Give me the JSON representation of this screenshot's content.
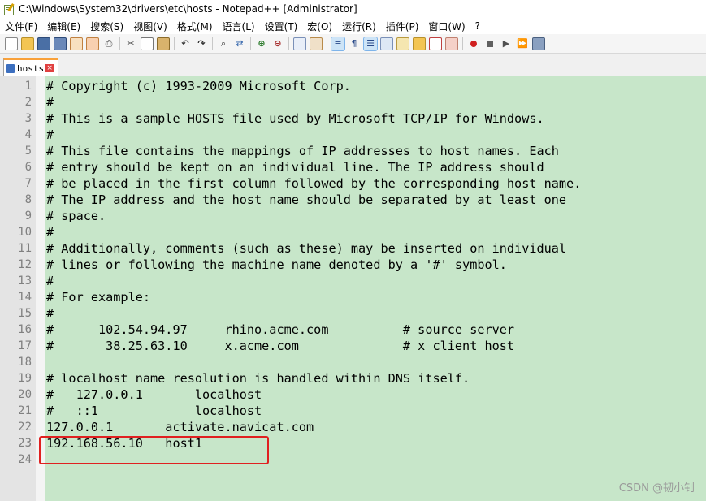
{
  "window": {
    "title": "C:\\Windows\\System32\\drivers\\etc\\hosts - Notepad++ [Administrator]"
  },
  "menu": [
    "文件(F)",
    "编辑(E)",
    "搜索(S)",
    "视图(V)",
    "格式(M)",
    "语言(L)",
    "设置(T)",
    "宏(O)",
    "运行(R)",
    "插件(P)",
    "窗口(W)",
    "?"
  ],
  "toolbar": {
    "buttons": [
      "new-file-icon",
      "open-file-icon",
      "save-icon",
      "save-all-icon",
      "close-icon",
      "close-all-icon",
      "print-icon",
      "cut-icon",
      "copy-icon",
      "paste-icon",
      "undo-icon",
      "redo-icon",
      "find-icon",
      "replace-icon",
      "zoom-in-icon",
      "zoom-out-icon",
      "sync-vertical-icon",
      "sync-horizontal-icon",
      "word-wrap-icon",
      "show-all-chars-icon",
      "indent-guide-icon",
      "doc-map-icon",
      "function-list-icon",
      "folder-workspace-icon",
      "monitoring-icon",
      "record-macro-icon",
      "stop-macro-icon",
      "play-macro-icon",
      "play-multiple-icon",
      "save-macro-icon"
    ]
  },
  "tab": {
    "label": "hosts"
  },
  "editor": {
    "lines": [
      "# Copyright (c) 1993-2009 Microsoft Corp.",
      "#",
      "# This is a sample HOSTS file used by Microsoft TCP/IP for Windows.",
      "#",
      "# This file contains the mappings of IP addresses to host names. Each",
      "# entry should be kept on an individual line. The IP address should",
      "# be placed in the first column followed by the corresponding host name.",
      "# The IP address and the host name should be separated by at least one",
      "# space.",
      "#",
      "# Additionally, comments (such as these) may be inserted on individual",
      "# lines or following the machine name denoted by a '#' symbol.",
      "#",
      "# For example:",
      "#",
      "#      102.54.94.97     rhino.acme.com          # source server",
      "#       38.25.63.10     x.acme.com              # x client host",
      "",
      "# localhost name resolution is handled within DNS itself.",
      "#   127.0.0.1       localhost",
      "#   ::1             localhost",
      "127.0.0.1       activate.navicat.com",
      "192.168.56.10   host1",
      ""
    ],
    "line_numbers": [
      "1",
      "2",
      "3",
      "4",
      "5",
      "6",
      "7",
      "8",
      "9",
      "10",
      "11",
      "12",
      "13",
      "14",
      "15",
      "16",
      "17",
      "18",
      "19",
      "20",
      "21",
      "22",
      "23",
      "24"
    ]
  },
  "watermark": "CSDN @韧小钊",
  "colors": {
    "text_background": "#c7e6c9",
    "gutter": "#e4e4e4",
    "highlight_box": "#e02020",
    "tab_accent": "#f9a13a"
  }
}
